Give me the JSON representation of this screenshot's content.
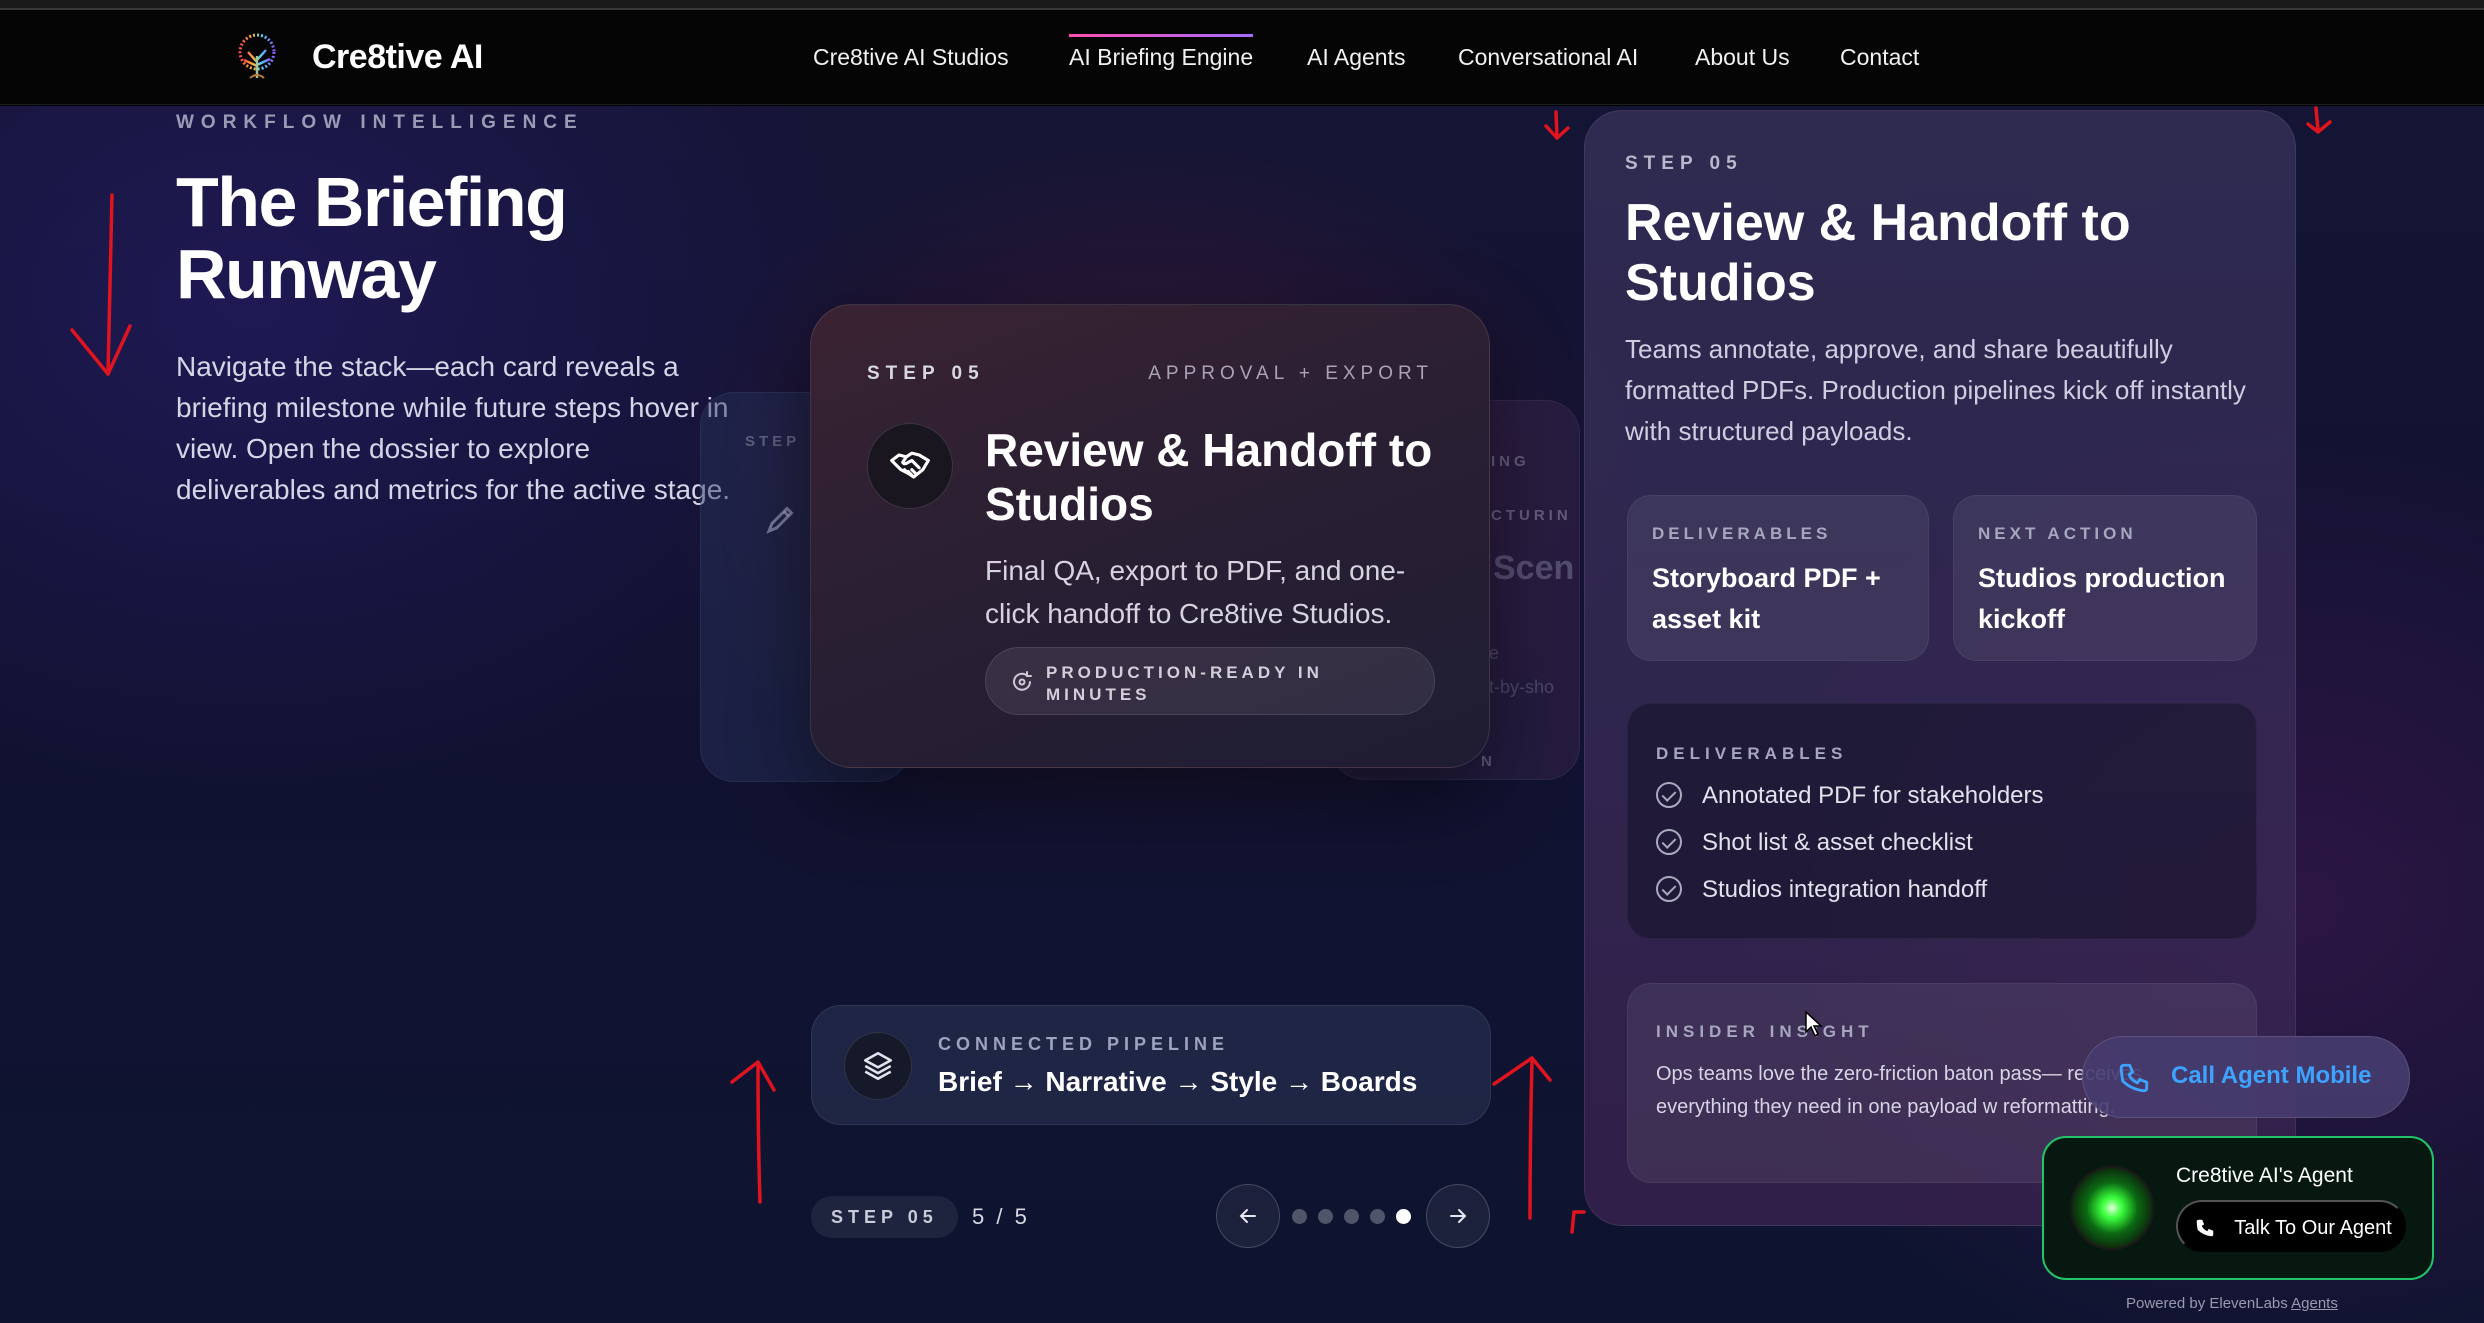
{
  "nav": {
    "brand": "Cre8tive AI",
    "items": [
      {
        "label": "Cre8tive AI Studios"
      },
      {
        "label": "AI Briefing Engine"
      },
      {
        "label": "AI Agents"
      },
      {
        "label": "Conversational AI"
      },
      {
        "label": "About Us"
      },
      {
        "label": "Contact"
      }
    ],
    "active_index": 1,
    "active_underline_colors": [
      "#ff4fb0",
      "#a36bff"
    ]
  },
  "hero": {
    "eyebrow": "WORKFLOW INTELLIGENCE",
    "title": "The Briefing Runway",
    "description": "Navigate the stack—each card reveals a briefing milestone while future steps hover in view. Open the dossier to explore deliverables and metrics for the active stage."
  },
  "ghost_cards": {
    "left_step": "STEP",
    "right_fragment_1": "ING",
    "right_fragment_2": "CTURIN",
    "right_title_fragment": "Scen",
    "right_desc_fragment_1": "he",
    "right_desc_fragment_2": "ot-by-sho",
    "right_pill_fragment": "N"
  },
  "active_card": {
    "step": "STEP 05",
    "category": "APPROVAL + EXPORT",
    "icon": "handshake-icon",
    "title": "Review & Handoff to Studios",
    "description": "Final QA, export to PDF, and one-click handoff to Cre8tive Studios.",
    "pill_icon": "refresh-icon",
    "pill_text": "PRODUCTION-READY IN MINUTES"
  },
  "pipeline": {
    "icon": "layers-icon",
    "label": "CONNECTED PIPELINE",
    "flow": "Brief → Narrative → Style → Boards"
  },
  "pager": {
    "step_badge": "STEP 05",
    "count": "5 / 5",
    "current": 5,
    "total": 5,
    "prev_icon": "arrow-left-icon",
    "next_icon": "arrow-right-icon"
  },
  "dossier": {
    "step": "STEP 05",
    "title": "Review & Handoff to Studios",
    "description": "Teams annotate, approve, and share beautifully formatted PDFs. Production pipelines kick off instantly with structured payloads.",
    "deliverables_box": {
      "label": "DELIVERABLES",
      "value": "Storyboard PDF + asset kit"
    },
    "next_action_box": {
      "label": "NEXT ACTION",
      "value": "Studios production kickoff"
    },
    "deliverables_list": {
      "label": "DELIVERABLES",
      "items": [
        "Annotated PDF for stakeholders",
        "Shot list & asset checklist",
        "Studios integration handoff"
      ]
    },
    "insight": {
      "label": "INSIDER INSIGHT",
      "text": "Ops teams love the zero-friction baton pass— receives everything they need in one payload w reformatting."
    }
  },
  "agent": {
    "call_mobile": "Call Agent Mobile",
    "name": "Cre8tive AI's Agent",
    "talk_button": "Talk To Our Agent",
    "powered_prefix": "Powered by ElevenLabs",
    "powered_link": "Agents",
    "accent": "#22c46a",
    "call_color": "#3da3ff"
  },
  "annotation_color": "#e0141e"
}
